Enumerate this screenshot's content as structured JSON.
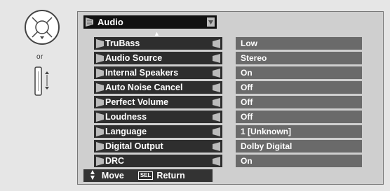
{
  "remote": {
    "or_label": "or"
  },
  "menu": {
    "title": "Audio",
    "items": [
      {
        "label": "TruBass",
        "value": "Low"
      },
      {
        "label": "Audio Source",
        "value": "Stereo"
      },
      {
        "label": "Internal Speakers",
        "value": "On"
      },
      {
        "label": "Auto Noise Cancel",
        "value": "Off"
      },
      {
        "label": "Perfect Volume",
        "value": "Off"
      },
      {
        "label": "Loudness",
        "value": "Off"
      },
      {
        "label": "Language",
        "value": "1 [Unknown]"
      },
      {
        "label": "Digital Output",
        "value": "Dolby Digital"
      },
      {
        "label": "DRC",
        "value": "On"
      }
    ]
  },
  "footer": {
    "move_label": "Move",
    "sel_button": "SEL",
    "return_label": "Return"
  },
  "colors": {
    "background": "#e6e6e6",
    "panel": "#cfcfcf",
    "item_bg": "#2e2e2e",
    "value_bg": "#6a6a6a"
  }
}
